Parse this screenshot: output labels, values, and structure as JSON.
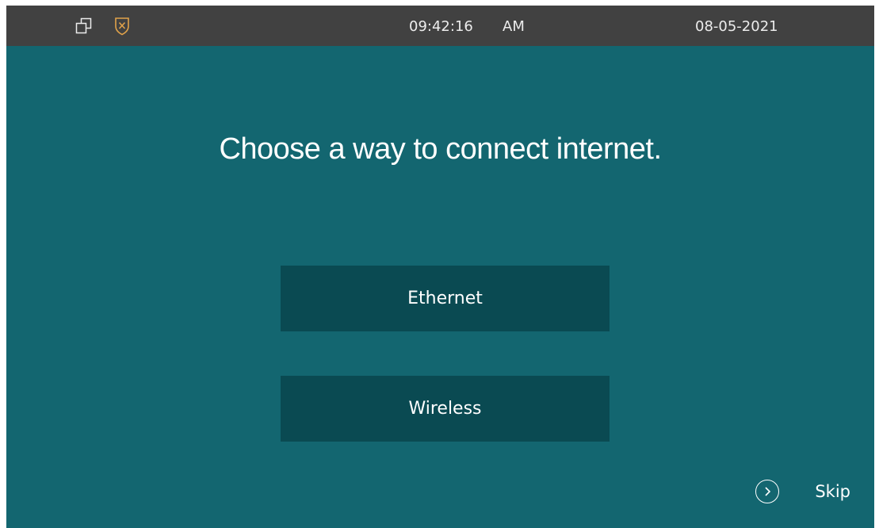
{
  "status_bar": {
    "time": "09:42:16",
    "meridiem": "AM",
    "date": "08-05-2021",
    "icons": [
      "windows-icon",
      "shield-x-icon"
    ]
  },
  "main": {
    "title": "Choose a way to connect internet.",
    "options": [
      {
        "label": "Ethernet"
      },
      {
        "label": "Wireless"
      }
    ],
    "skip_label": "Skip"
  },
  "colors": {
    "screen_bg": "#136670",
    "status_bar_bg": "#414141",
    "button_bg": "#0a4a52",
    "shield_accent": "#e0a24a",
    "text": "#ffffff"
  }
}
